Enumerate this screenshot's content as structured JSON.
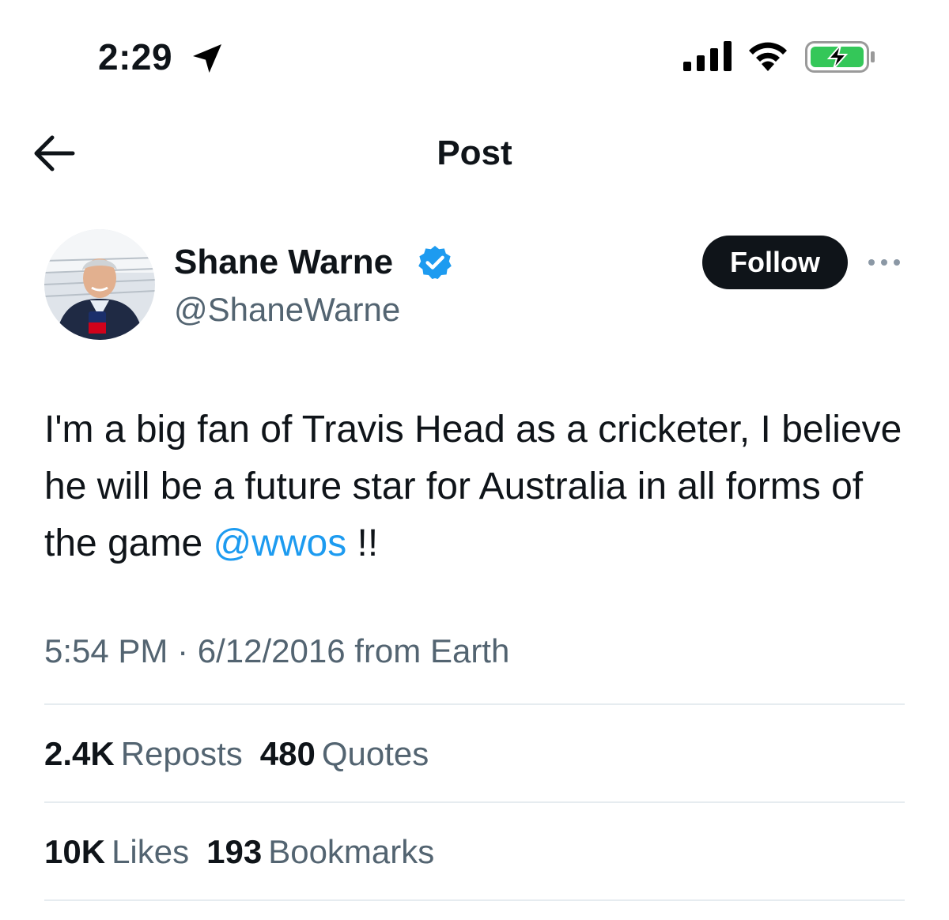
{
  "status_bar": {
    "time": "2:29",
    "location_icon": "location-arrow-icon",
    "signal_icon": "cellular-signal-icon",
    "wifi_icon": "wifi-icon",
    "battery_icon": "battery-charging-icon",
    "battery_color": "#34c759"
  },
  "header": {
    "title": "Post",
    "back_icon": "back-arrow-icon"
  },
  "author": {
    "name": "Shane Warne",
    "handle": "@ShaneWarne",
    "verified_color": "#1d9bf0",
    "follow_label": "Follow",
    "more_icon": "more-options-icon"
  },
  "tweet": {
    "text_before": "I'm a big fan of Travis Head as a cricketer, I believe he will be a future star for Australia in all forms of the game ",
    "mention": "@wwos",
    "text_after": " !!",
    "mention_color": "#1d9bf0"
  },
  "meta": {
    "time": "5:54 PM",
    "separator": " · ",
    "date": "6/12/2016",
    "source": " from Earth"
  },
  "stats": {
    "reposts_count": "2.4K",
    "reposts_label": "Reposts",
    "quotes_count": "480",
    "quotes_label": "Quotes",
    "likes_count": "10K",
    "likes_label": "Likes",
    "bookmarks_count": "193",
    "bookmarks_label": "Bookmarks"
  }
}
